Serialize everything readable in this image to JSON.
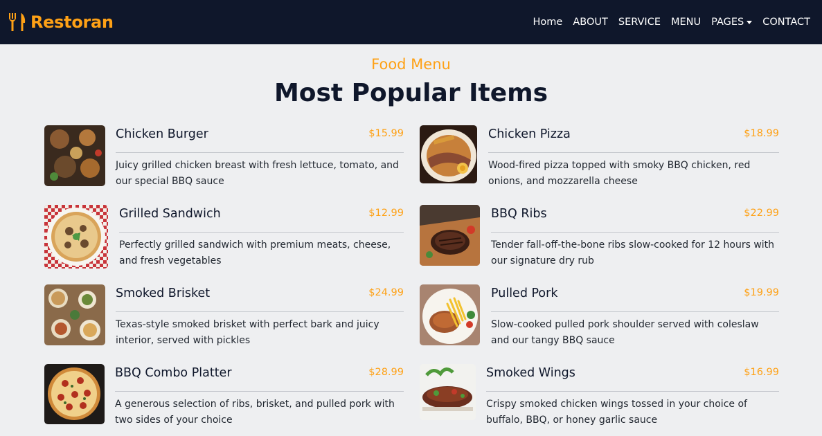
{
  "brand": {
    "name": "Restoran",
    "icon": "utensils-icon",
    "color": "#fea116"
  },
  "nav": [
    {
      "label": "Home"
    },
    {
      "label": "ABOUT"
    },
    {
      "label": "SERVICE"
    },
    {
      "label": "MENU"
    },
    {
      "label": "PAGES"
    },
    {
      "label": "CONTACT"
    }
  ],
  "section": {
    "subtitle": "Food Menu",
    "title": "Most Popular Items"
  },
  "items": [
    {
      "name": "Chicken Burger",
      "price": "$15.99",
      "description": "Juicy grilled chicken breast with fresh lettuce, tomato, and our special BBQ sauce"
    },
    {
      "name": "Chicken Pizza",
      "price": "$18.99",
      "description": "Wood-fired pizza topped with smoky BBQ chicken, red onions, and mozzarella cheese"
    },
    {
      "name": "Grilled Sandwich",
      "price": "$12.99",
      "description": "Perfectly grilled sandwich with premium meats, cheese, and fresh vegetables"
    },
    {
      "name": "BBQ Ribs",
      "price": "$22.99",
      "description": "Tender fall-off-the-bone ribs slow-cooked for 12 hours with our signature dry rub"
    },
    {
      "name": "Smoked Brisket",
      "price": "$24.99",
      "description": "Texas-style smoked brisket with perfect bark and juicy interior, served with pickles"
    },
    {
      "name": "Pulled Pork",
      "price": "$19.99",
      "description": "Slow-cooked pulled pork shoulder served with coleslaw and our tangy BBQ sauce"
    },
    {
      "name": "BBQ Combo Platter",
      "price": "$28.99",
      "description": "A generous selection of ribs, brisket, and pulled pork with two sides of your choice"
    },
    {
      "name": "Smoked Wings",
      "price": "$16.99",
      "description": "Crispy smoked chicken wings tossed in your choice of buffalo, BBQ, or honey garlic sauce"
    }
  ]
}
